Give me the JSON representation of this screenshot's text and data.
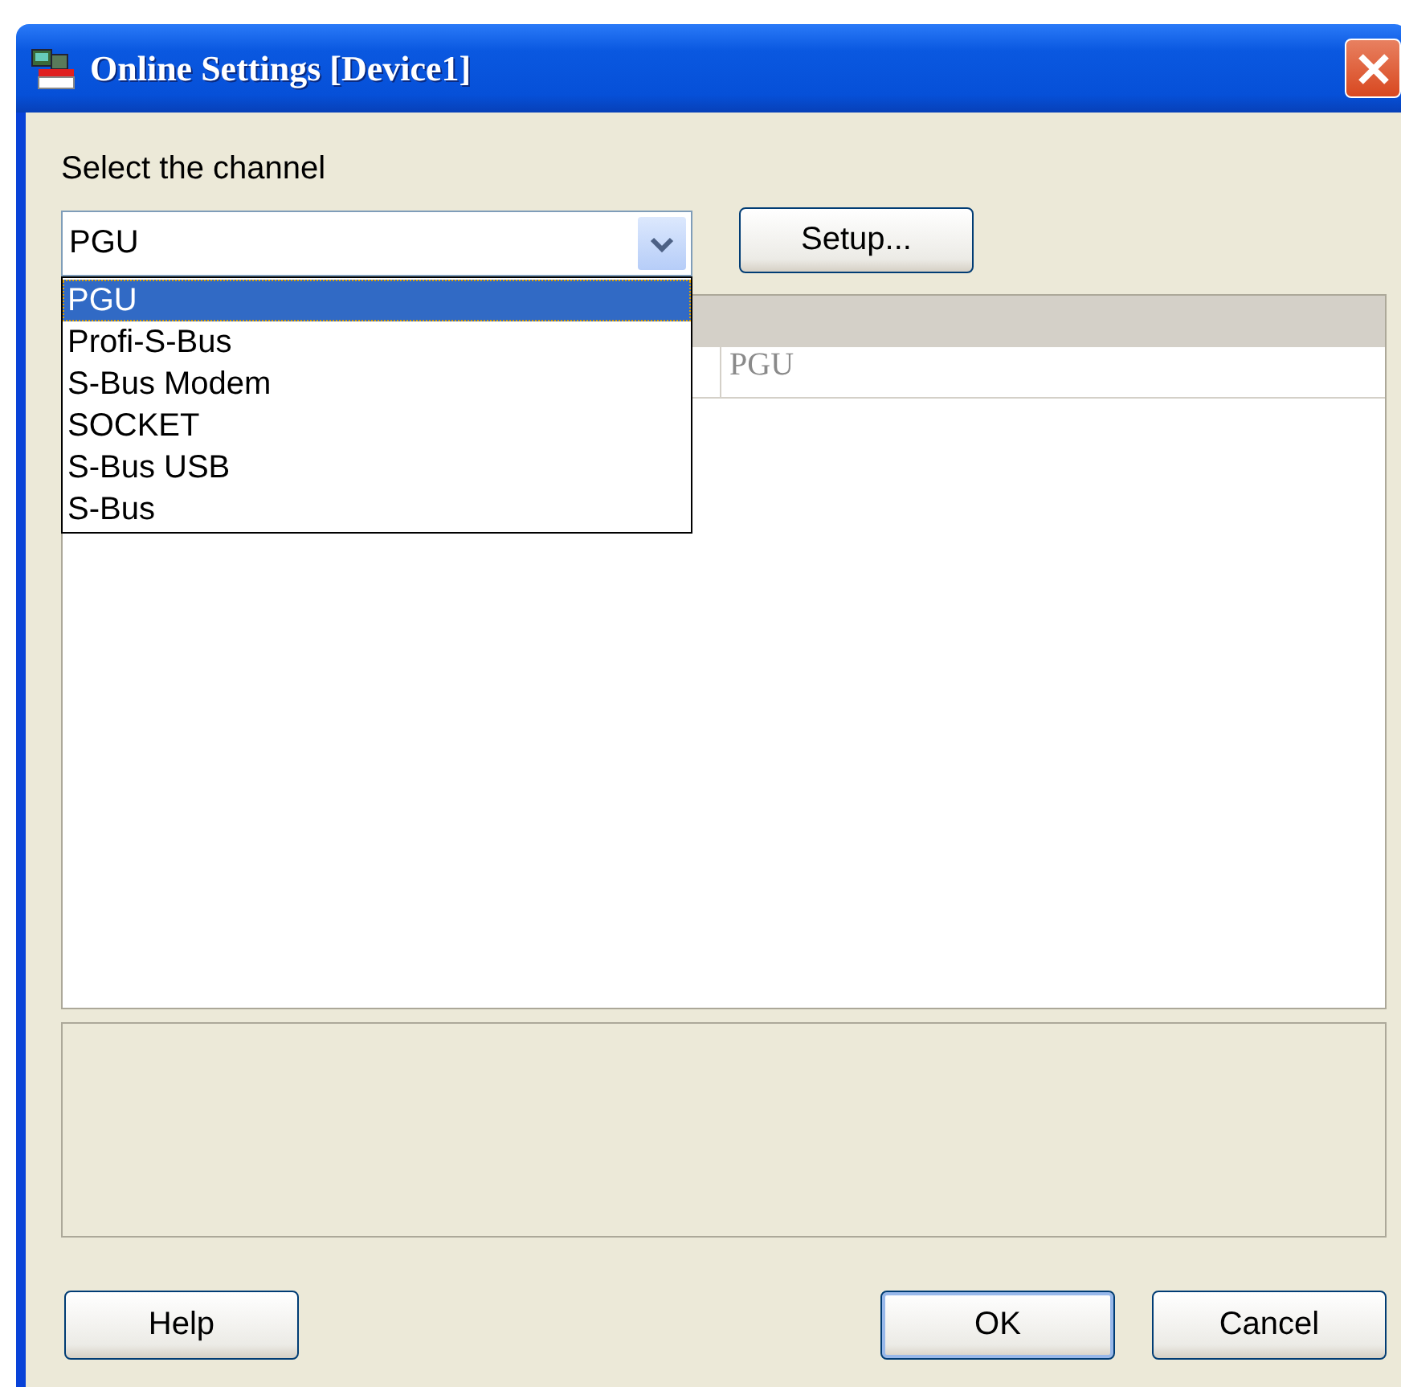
{
  "window": {
    "title": "Online Settings [Device1]"
  },
  "channel_label": "Select the channel",
  "channel_combo": {
    "value": "PGU",
    "expanded": true,
    "options": [
      {
        "label": "PGU",
        "selected": true
      },
      {
        "label": "Profi-S-Bus",
        "selected": false
      },
      {
        "label": "S-Bus Modem",
        "selected": false
      },
      {
        "label": "SOCKET",
        "selected": false
      },
      {
        "label": "S-Bus USB",
        "selected": false
      },
      {
        "label": "S-Bus",
        "selected": false
      }
    ]
  },
  "setup_button": {
    "label": "Setup..."
  },
  "table": {
    "rows": [
      {
        "column_2": "PGU"
      }
    ]
  },
  "buttons": [
    {
      "label": "Help",
      "default": false
    },
    {
      "label": "OK",
      "default": true
    },
    {
      "label": "Cancel",
      "default": false
    }
  ]
}
